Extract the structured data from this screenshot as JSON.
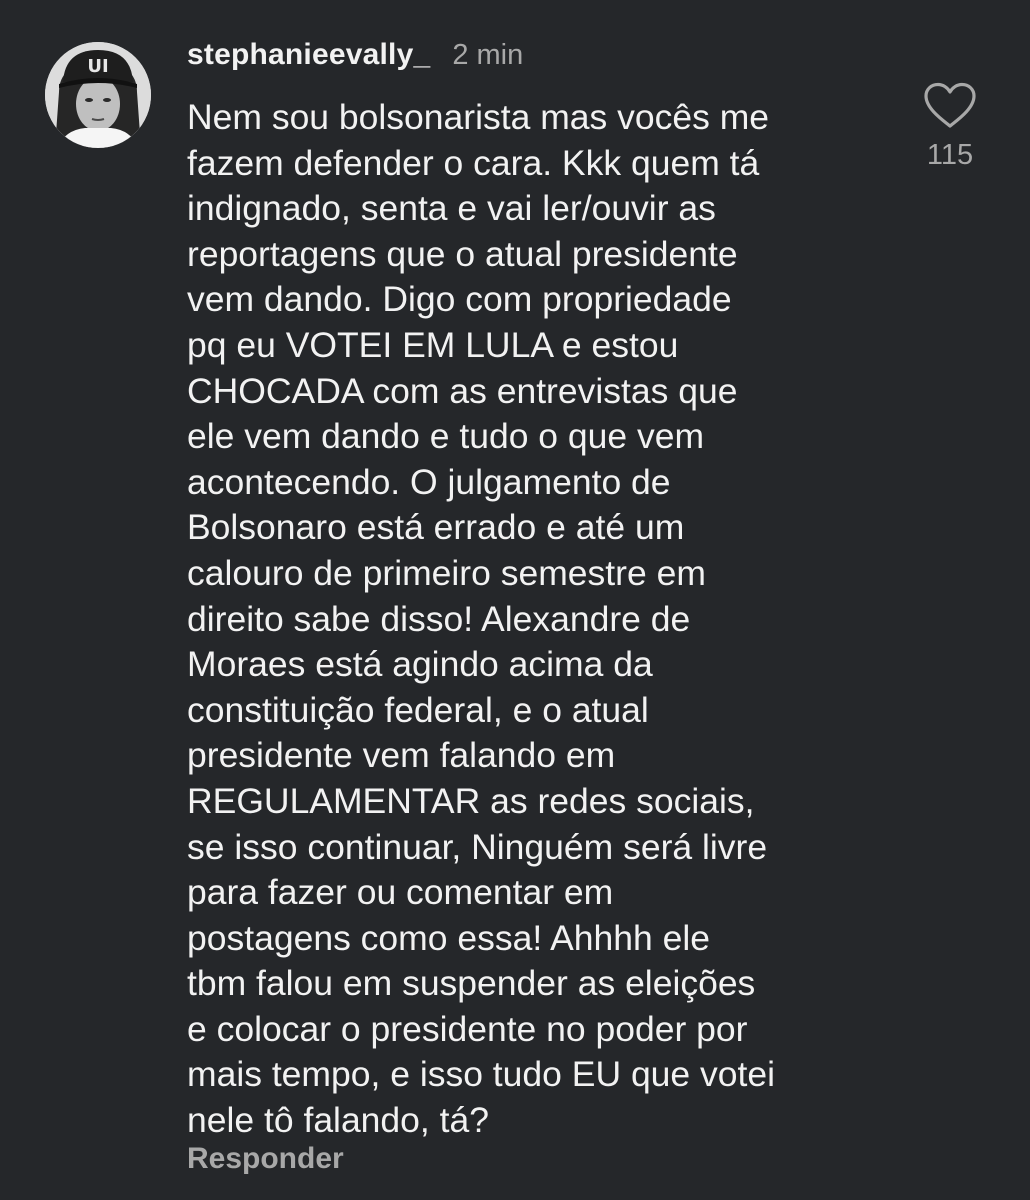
{
  "comment": {
    "username": "stephanieevally_",
    "timestamp": "2 min",
    "lines": [
      "Nem sou bolsonarista mas vocês me",
      "fazem defender o cara. Kkk quem tá",
      "indignado, senta e vai ler/ouvir as",
      "reportagens que o atual presidente",
      "vem dando. Digo com propriedade",
      "pq eu VOTEI EM LULA e estou",
      "CHOCADA com as entrevistas que",
      "ele vem dando e tudo o que vem",
      "acontecendo. O julgamento de",
      "Bolsonaro está errado e até um",
      "calouro de primeiro semestre em",
      "direito sabe disso! Alexandre de",
      "Moraes está agindo acima da",
      "constituição federal, e o atual",
      "presidente vem falando em",
      "REGULAMENTAR as redes sociais,",
      "se isso continuar, Ninguém será livre",
      "para fazer ou comentar em",
      "postagens como essa! Ahhhh ele",
      "tbm falou em suspender as eleições",
      "e colocar o presidente no poder por",
      "mais tempo, e isso tudo EU que votei",
      "nele tô falando, tá?"
    ],
    "like_icon": "heart-outline-icon",
    "like_count": "115",
    "reply_label": "Responder",
    "avatar_cap_text": "UI"
  },
  "colors": {
    "background": "#25272a",
    "primary_text": "#f2f2f2",
    "secondary_text": "#a8a8a8"
  }
}
